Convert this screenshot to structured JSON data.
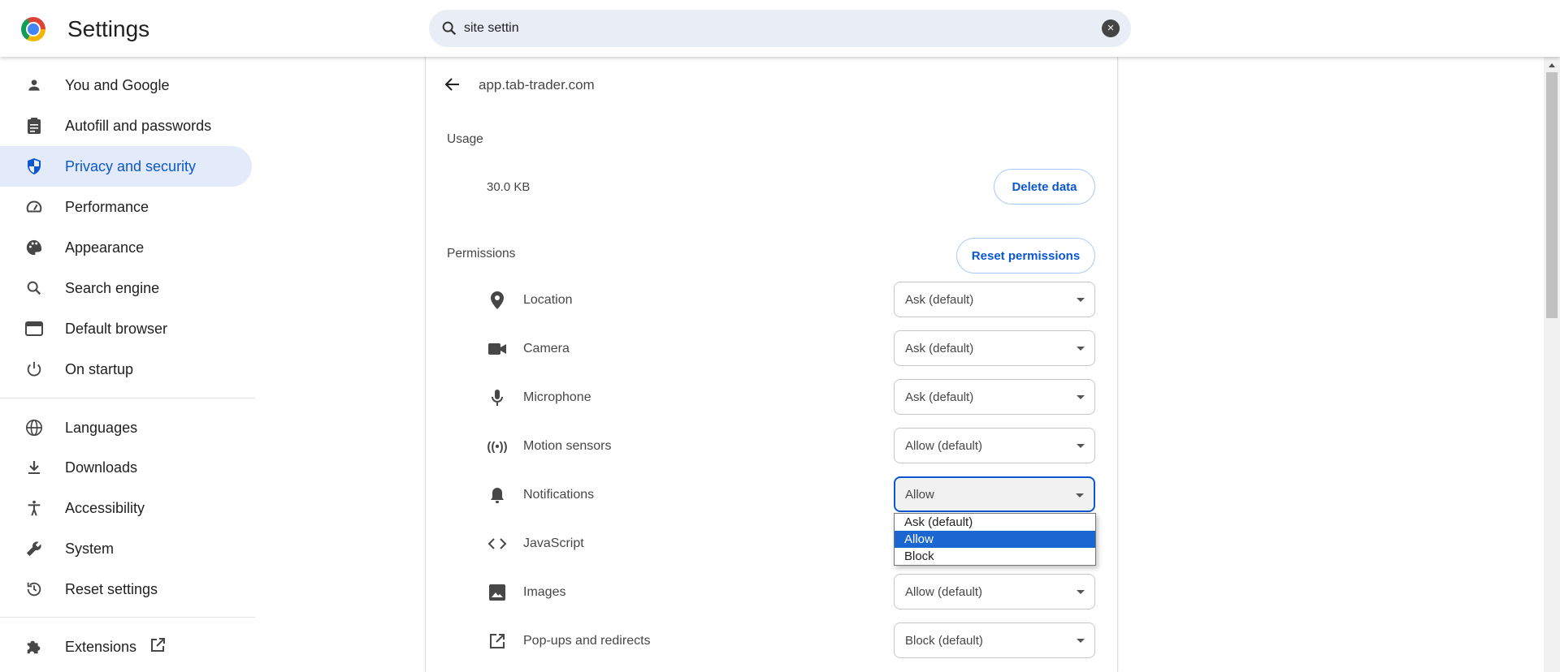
{
  "header": {
    "title": "Settings",
    "search_value": "site settin",
    "search_icon": "search-icon",
    "clear_icon": "close-icon"
  },
  "sidebar": {
    "items": [
      {
        "label": "You and Google",
        "icon": "person-icon"
      },
      {
        "label": "Autofill and passwords",
        "icon": "clipboard-icon"
      },
      {
        "label": "Privacy and security",
        "icon": "shield-icon",
        "selected": true
      },
      {
        "label": "Performance",
        "icon": "speedometer-icon"
      },
      {
        "label": "Appearance",
        "icon": "palette-icon"
      },
      {
        "label": "Search engine",
        "icon": "search-icon"
      },
      {
        "label": "Default browser",
        "icon": "browser-icon"
      },
      {
        "label": "On startup",
        "icon": "power-icon"
      },
      {
        "label": "Languages",
        "icon": "globe-icon"
      },
      {
        "label": "Downloads",
        "icon": "download-icon"
      },
      {
        "label": "Accessibility",
        "icon": "accessibility-icon"
      },
      {
        "label": "System",
        "icon": "wrench-icon"
      },
      {
        "label": "Reset settings",
        "icon": "history-icon"
      },
      {
        "label": "Extensions",
        "icon": "puzzle-icon",
        "external_icon": "open-in-new-icon"
      }
    ]
  },
  "site": {
    "name": "app.tab-trader.com",
    "usage_label": "Usage",
    "usage_value": "30.0 KB",
    "delete_label": "Delete data",
    "permissions_label": "Permissions",
    "reset_label": "Reset permissions"
  },
  "permissions": [
    {
      "label": "Location",
      "value": "Ask (default)",
      "icon": "location-pin-icon"
    },
    {
      "label": "Camera",
      "value": "Ask (default)",
      "icon": "camera-icon"
    },
    {
      "label": "Microphone",
      "value": "Ask (default)",
      "icon": "microphone-icon"
    },
    {
      "label": "Motion sensors",
      "value": "Allow (default)",
      "icon": "motion-sensor-icon"
    },
    {
      "label": "Notifications",
      "value": "Allow",
      "icon": "bell-icon"
    },
    {
      "label": "JavaScript",
      "value": "",
      "icon": "code-icon"
    },
    {
      "label": "Images",
      "value": "Allow (default)",
      "icon": "image-icon"
    },
    {
      "label": "Pop-ups and redirects",
      "value": "Block (default)",
      "icon": "open-in-new-icon"
    }
  ],
  "dropdown": {
    "options": [
      "Ask (default)",
      "Allow",
      "Block"
    ],
    "highlighted": "Allow"
  },
  "colors": {
    "accent": "#0b57d0",
    "selected_bg": "#e3ebfa",
    "dropdown_highlight": "#1a67d2"
  }
}
